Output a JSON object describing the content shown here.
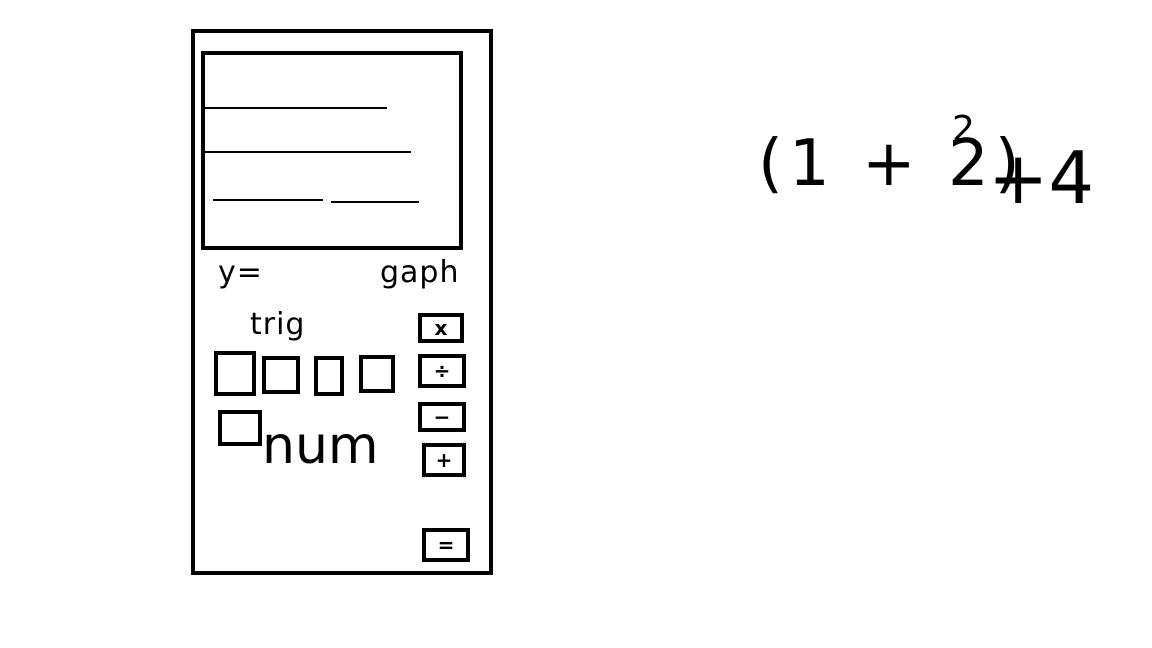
{
  "calculator": {
    "labels": {
      "y_equals": "y=",
      "graph": "gaph",
      "trig": "trig",
      "num": "num"
    },
    "operators": {
      "multiply": "x",
      "divide": "÷",
      "subtract": "−",
      "add": "+",
      "equals": "="
    }
  },
  "expression": {
    "base": "(1 + 2)",
    "exponent": "2",
    "rest": "+4"
  }
}
